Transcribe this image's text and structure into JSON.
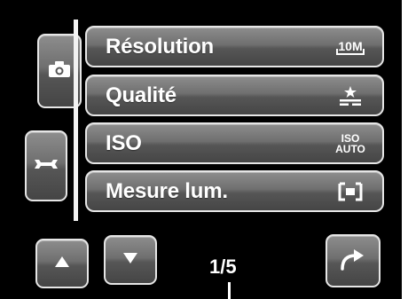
{
  "tabs": [
    {
      "icon": "camera-icon"
    },
    {
      "icon": "wrench-icon"
    }
  ],
  "menu": {
    "items": [
      {
        "label": "Résolution",
        "icon": "resolution-10m-icon",
        "icon_text": "10M"
      },
      {
        "label": "Qualité",
        "icon": "quality-stars-icon"
      },
      {
        "label": "ISO",
        "icon": "iso-auto-icon",
        "icon_text_top": "ISO",
        "icon_text_bottom": "AUTO"
      },
      {
        "label": "Mesure lum.",
        "icon": "metering-center-icon"
      }
    ]
  },
  "nav": {
    "up_icon": "triangle-up-icon",
    "down_icon": "triangle-down-icon",
    "exit_icon": "curved-arrow-icon",
    "page": "1/5"
  },
  "colors": {
    "background": "#000000",
    "button_top": "#8d8d8d",
    "button_bottom": "#454545",
    "border": "#e6e6e6",
    "text": "#ffffff"
  }
}
